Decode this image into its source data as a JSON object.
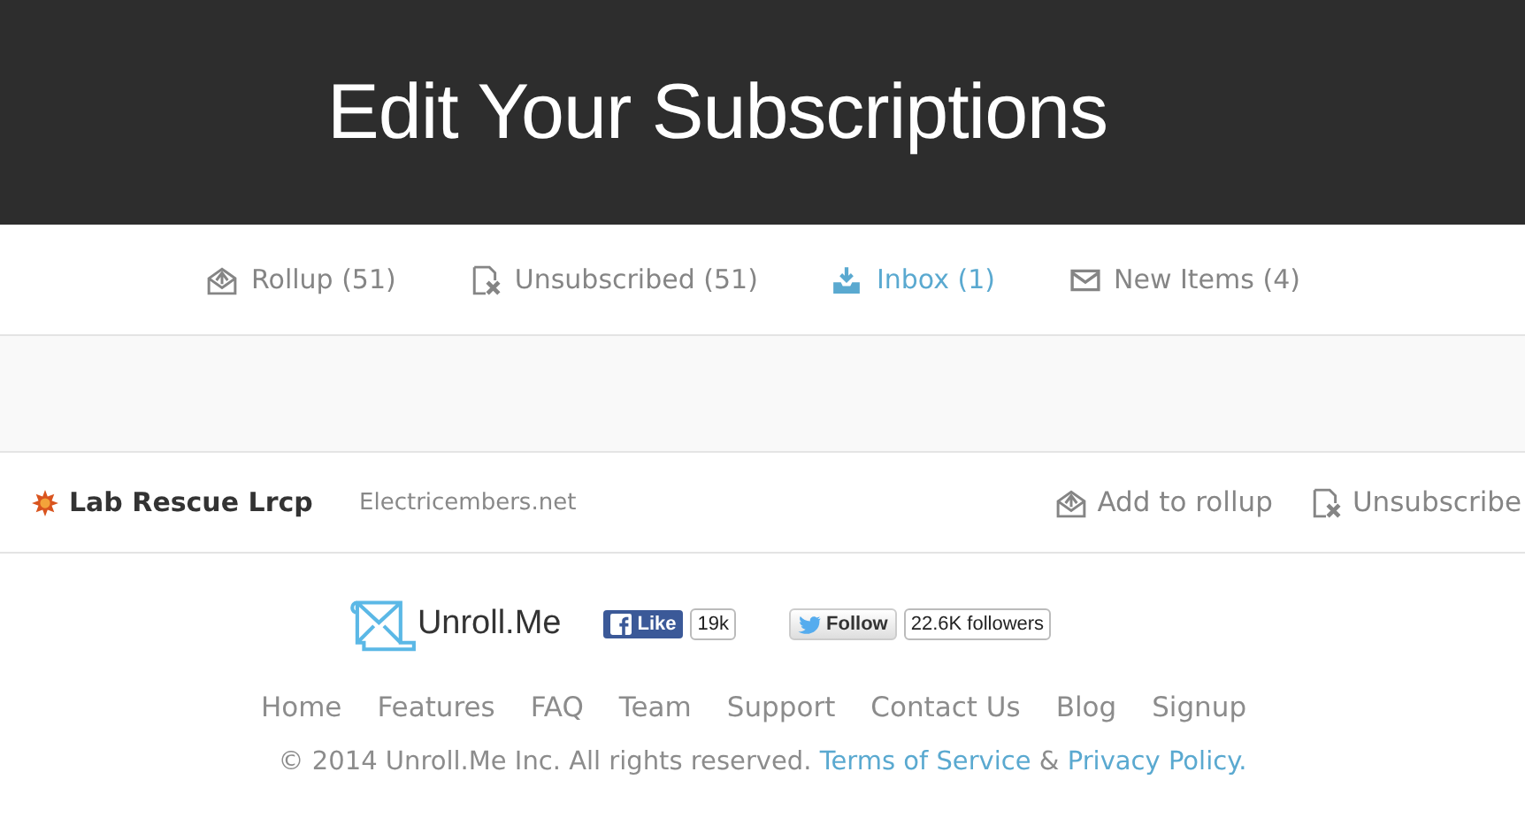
{
  "header": {
    "title": "Edit Your Subscriptions"
  },
  "tabs": [
    {
      "label": "Rollup (51)",
      "kind": "rollup",
      "selected": false
    },
    {
      "label": "Unsubscribed (51)",
      "kind": "unsubscribed",
      "selected": false
    },
    {
      "label": "Inbox (1)",
      "kind": "inbox",
      "selected": true
    },
    {
      "label": "New Items (4)",
      "kind": "new",
      "selected": false
    }
  ],
  "subscriptions": [
    {
      "name": "Lab Rescue Lrcp",
      "domain": "Electricembers.net",
      "actions": [
        {
          "label": "Add to rollup",
          "kind": "rollup"
        },
        {
          "label": "Unsubscribe",
          "kind": "unsubscribed"
        }
      ]
    }
  ],
  "footer": {
    "logo": "Unroll.Me",
    "like": {
      "label": "Like",
      "count": "19k"
    },
    "follow": {
      "label": "Follow",
      "count": "22.6K followers"
    },
    "nav": [
      "Home",
      "Features",
      "FAQ",
      "Team",
      "Support",
      "Contact Us",
      "Blog",
      "Signup"
    ],
    "copyright": "© 2014 Unroll.Me Inc. All rights reserved.",
    "terms": "Terms of Service",
    "amp": "&",
    "privacy": "Privacy Policy."
  }
}
